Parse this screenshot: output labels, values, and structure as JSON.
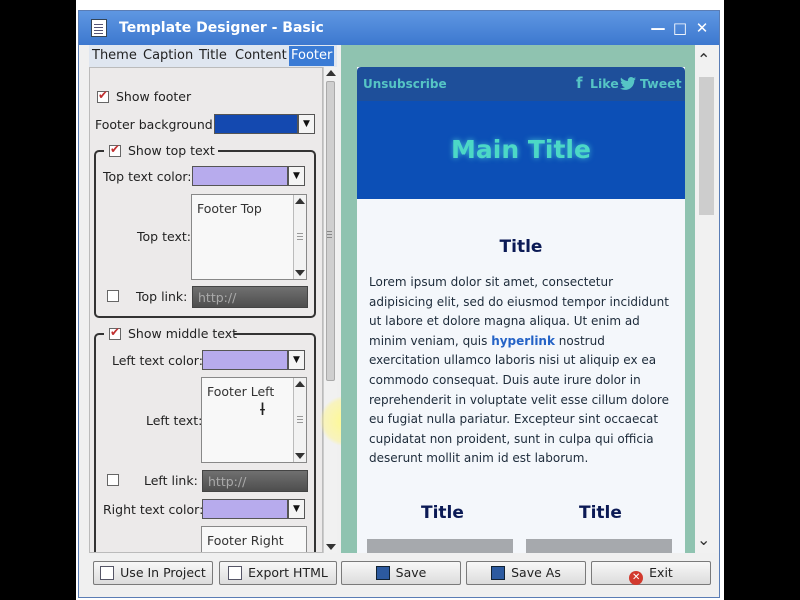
{
  "window": {
    "title": "Template Designer - Basic"
  },
  "tabs": [
    {
      "label": "Theme",
      "active": false
    },
    {
      "label": "Caption",
      "active": false
    },
    {
      "label": "Title",
      "active": false
    },
    {
      "label": "Content",
      "active": false
    },
    {
      "label": "Footer",
      "active": true
    }
  ],
  "footer": {
    "show_footer_label": "Show footer",
    "show_footer_checked": true,
    "background_label": "Footer background:",
    "background_color": "#1449b0",
    "top": {
      "group_label": "Show top text",
      "checked": true,
      "color_label": "Top text color:",
      "color": "#b7abed",
      "text_label": "Top text:",
      "text_value": "Footer Top",
      "link_label": "Top link:",
      "link_checked": false,
      "link_placeholder": "http://"
    },
    "middle": {
      "group_label": "Show middle text",
      "checked": true,
      "left_color_label": "Left text color:",
      "left_color": "#b7abed",
      "left_text_label": "Left text:",
      "left_text_value": "Footer Left",
      "left_link_label": "Left link:",
      "left_link_checked": false,
      "left_link_placeholder": "http://",
      "right_color_label": "Right text color:",
      "right_color": "#b7abed",
      "right_text_value": "Footer Right"
    }
  },
  "preview": {
    "unsubscribe": "Unsubscribe",
    "like": "Like",
    "tweet": "Tweet",
    "main_title": "Main Title",
    "content_title": "Title",
    "body_before_link": "Lorem ipsum dolor sit amet, consectetur adipisicing elit, sed do eiusmod tempor incididunt ut labore et dolore magna aliqua. Ut enim ad minim veniam, quis ",
    "body_link": "hyperlink",
    "body_after_link": " nostrud exercitation ullamco laboris nisi ut aliquip ex ea commodo consequat. Duis aute irure dolor in reprehenderit in voluptate velit esse cillum dolore eu fugiat nulla pariatur. Excepteur sint occaecat cupidatat non proident, sunt in culpa qui officia deserunt mollit anim id est laborum.",
    "col_title_left": "Title",
    "col_title_right": "Title"
  },
  "buttons": {
    "use_in_project": "Use In Project",
    "export_html": "Export HTML",
    "save": "Save",
    "save_as": "Save As",
    "exit": "Exit"
  }
}
